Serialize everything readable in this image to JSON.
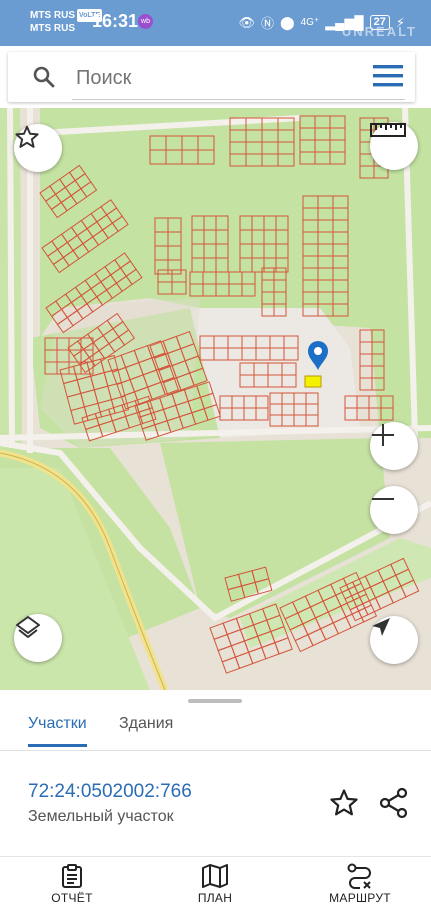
{
  "status_bar": {
    "carrier_1": "MTS RUS",
    "carrier_volte": "VoLTE",
    "carrier_2": "MTS RUS",
    "time": "16:31",
    "app_badge": "wb",
    "network": "4G⁺",
    "battery": "27",
    "watermark": "UNREALT"
  },
  "search": {
    "placeholder": "Поиск"
  },
  "map": {
    "marker_color": "#1c6fc7",
    "parcel_line_color": "#d4553a",
    "selected_parcel_color": "#f5f200"
  },
  "tabs": {
    "parcels": "Участки",
    "buildings": "Здания"
  },
  "parcel": {
    "cadastral_number": "72:24:0502002:766",
    "type": "Земельный участок"
  },
  "bottom_nav": {
    "report": "ОТЧЁТ",
    "plan": "ПЛАН",
    "route": "МАРШРУТ"
  }
}
